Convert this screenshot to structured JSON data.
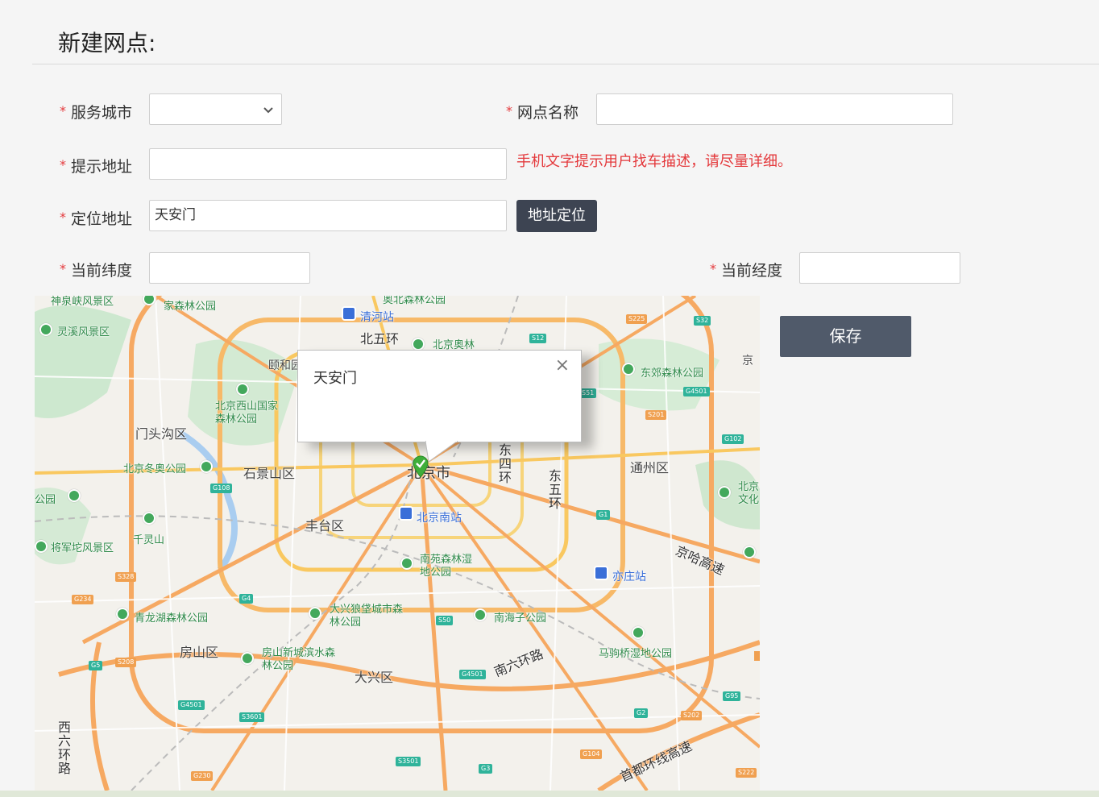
{
  "page": {
    "title": "新建网点:"
  },
  "form": {
    "city": {
      "label": "服务城市",
      "value": ""
    },
    "name": {
      "label": "网点名称",
      "value": ""
    },
    "hint_address": {
      "label": "提示地址",
      "value": "",
      "help": "手机文字提示用户找车描述，请尽量详细。"
    },
    "locate_address": {
      "label": "定位地址",
      "value": "天安门",
      "button": "地址定位"
    },
    "latitude": {
      "label": "当前纬度",
      "value": ""
    },
    "longitude": {
      "label": "当前经度",
      "value": ""
    },
    "required_mark": "*"
  },
  "save_button": "保存",
  "map": {
    "popup_text": "天安门",
    "popup_close": "×",
    "labels": {
      "city_center": "北京市",
      "qinghe": "清河站",
      "beiwuhuan": "北五环",
      "aoli": "北京奥林",
      "aoli_top": "奥北森林公园",
      "yiheyuan": "颐和园",
      "xishan": "北京西山国家森林公园",
      "mentougou": "门头沟区",
      "dongao": "北京冬奥公园",
      "shijingshan": "石景山区",
      "fengtai": "丰台区",
      "beijingnan": "北京南站",
      "dongsihuan": "东四环",
      "dongwuhuan": "东五环",
      "tongzhou": "通州区",
      "dongjiao": "东郊森林公园",
      "lingxi": "灵溪风景区",
      "shenquan": "神泉峡风景区",
      "jia_senlin": "家森林公园",
      "qianlingshan": "千灵山",
      "jiangjuntuo": "将军坨风景区",
      "gongyuan_left": "公园",
      "nanyuan": "南苑森林湿地公园",
      "yizhuang": "亦庄站",
      "jingha": "京哈高速",
      "qinglonghu": "青龙湖森林公园",
      "daxing_park": "大兴狼垡城市森林公园",
      "nanhaizi": "南海子公园",
      "fangshan": "房山区",
      "fangshan_park": "房山新城滨水森林公园",
      "daxing": "大兴区",
      "nanliuhuan": "南六环路",
      "majuqiao": "马驹桥湿地公园",
      "xiliuhuan": "西六环路",
      "shoudu": "首都环线高速",
      "bei_right": "北京文化",
      "jing_right": "京"
    },
    "shields": [
      "S12",
      "S225",
      "S32",
      "S51",
      "G4501",
      "S201",
      "G102",
      "G108",
      "G1",
      "G4",
      "G234",
      "S328",
      "S50",
      "G5",
      "S208",
      "G4501",
      "G4501",
      "S3601",
      "S3501",
      "G3",
      "G104",
      "G2",
      "S202",
      "G95",
      "G230",
      "S222"
    ]
  }
}
